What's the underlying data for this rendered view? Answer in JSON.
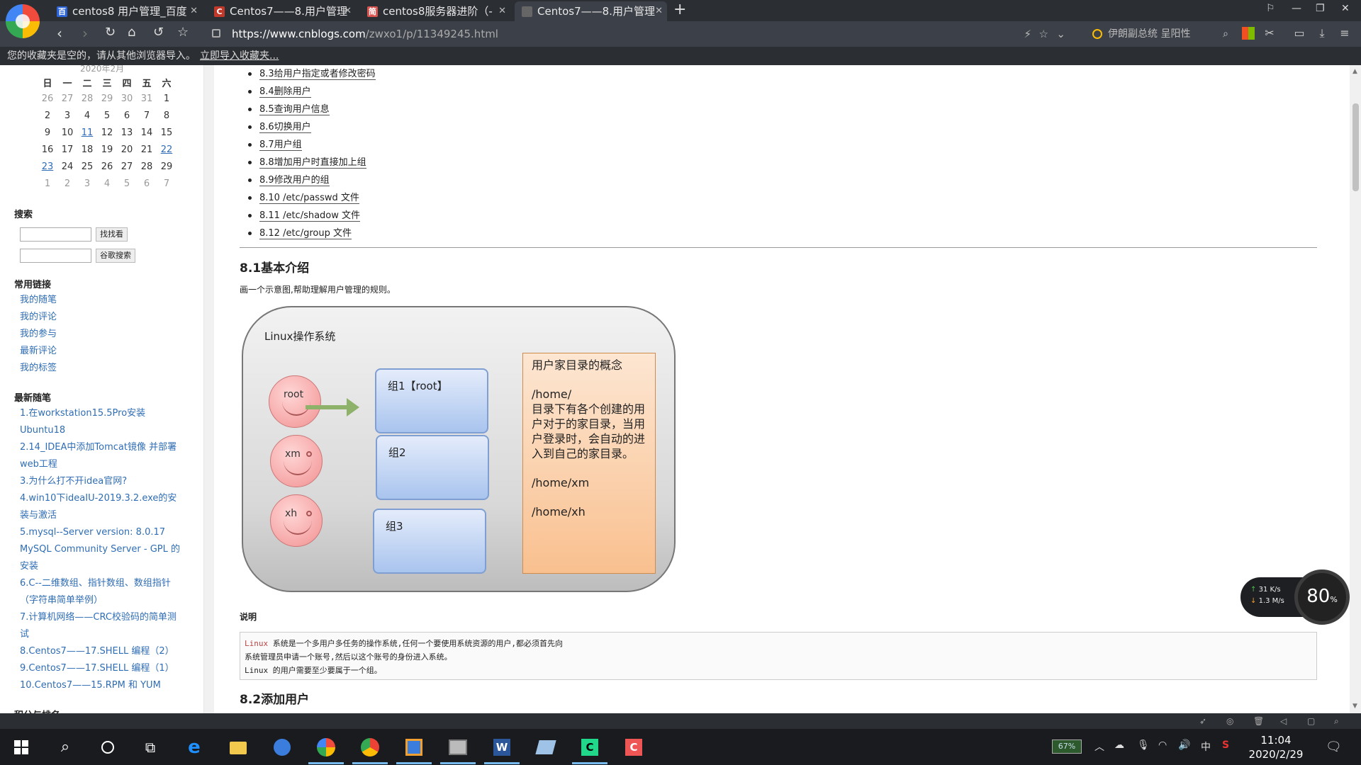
{
  "browser": {
    "tabs": [
      {
        "label": "centos8 用户管理_百度",
        "favicon_color": "#2d64d8",
        "favicon": "百"
      },
      {
        "label": "Centos7——8.用户管理",
        "favicon_color": "#c0392b",
        "favicon": "C"
      },
      {
        "label": "centos8服务器进阶（-",
        "favicon_color": "#d9534f",
        "favicon": "简"
      },
      {
        "label": "Centos7——8.用户管理",
        "favicon_color": "#666666",
        "favicon": ""
      }
    ],
    "url_host": "https://www.cnblogs.com",
    "url_path": "/zwxo1/p/11349245.html",
    "search_text": "伊朗副总统 呈阳性",
    "favbar_text": "您的收藏夹是空的，请从其他浏览器导入。",
    "favbar_link": "立即导入收藏夹..."
  },
  "sidebar": {
    "calendar": {
      "header": "2020年2月",
      "weekdays": [
        "日",
        "一",
        "二",
        "三",
        "四",
        "五",
        "六"
      ],
      "weeks": [
        [
          "26",
          "27",
          "28",
          "29",
          "30",
          "31",
          "1"
        ],
        [
          "2",
          "3",
          "4",
          "5",
          "6",
          "7",
          "8"
        ],
        [
          "9",
          "10",
          "11",
          "12",
          "13",
          "14",
          "15"
        ],
        [
          "16",
          "17",
          "18",
          "19",
          "20",
          "21",
          "22"
        ],
        [
          "23",
          "24",
          "25",
          "26",
          "27",
          "28",
          "29"
        ],
        [
          "1",
          "2",
          "3",
          "4",
          "5",
          "6",
          "7"
        ]
      ]
    },
    "search_title": "搜索",
    "search_btn": "找找看",
    "google_btn": "谷歌搜索",
    "links_title": "常用链接",
    "links": [
      "我的随笔",
      "我的评论",
      "我的参与",
      "最新评论",
      "我的标签"
    ],
    "recent_title": "最新随笔",
    "recent": [
      "1.在workstation15.5Pro安装",
      "Ubuntu18",
      "2.14_IDEA中添加Tomcat镜像 并部署",
      "web工程",
      "3.为什么打不开idea官网?",
      "4.win10下ideaIU-2019.3.2.exe的安",
      "装与激活",
      "5.mysql--Server version: 8.0.17",
      "MySQL Community Server - GPL 的",
      "安装",
      "6.C--二维数组、指针数组、数组指针",
      "（字符串简单举例）",
      "7.计算机网络——CRC校验码的简单测",
      "试",
      "8.Centos7——17.SHELL 编程（2）",
      "9.Centos7——17.SHELL 编程（1）",
      "10.Centos7——15.RPM 和 YUM"
    ],
    "rank_title": "积分与排名"
  },
  "content": {
    "toc": [
      "8.3给用户指定或者修改密码",
      "8.4删除用户",
      "8.5查询用户信息",
      "8.6切换用户",
      "8.7用户组",
      "8.8增加用户时直接加上组",
      "8.9修改用户的组",
      "8.10 /etc/passwd 文件",
      "8.11 /etc/shadow 文件",
      "8.12 /etc/group 文件"
    ],
    "sec1_title": "8.1基本介绍",
    "sec1_para": "画一个示意图,帮助理解用户管理的规则。",
    "diagram": {
      "title": "Linux操作系统",
      "users": [
        "root",
        "xm",
        "xh"
      ],
      "groups": [
        "组1【root】",
        "组2",
        "组3"
      ],
      "home_title": "用户家目录的概念",
      "home_lines": [
        "/home/",
        "目录下有各个创建的用户对于的家目录，当用户登录时，会自动的进入到自己的家目录。",
        "/home/xm",
        "/home/xh"
      ]
    },
    "note_title": "说明",
    "code_kw": "Linux",
    "code_line1_rest": " 系统是一个多用户多任务的操作系统,任何一个要使用系统资源的用户,都必须首先向",
    "code_line2": "系统管理员申请一个账号,然后以这个账号的身份进入系统。",
    "code_line3": "Linux 的用户需要至少要属于一个组。",
    "sec2_title": "8.2添加用户"
  },
  "netwidget": {
    "up": "31  K/s",
    "down": "1.3  M/s",
    "percent": "80",
    "percent_unit": "%"
  },
  "taskbar": {
    "battery": "67%",
    "time": "11:04",
    "date": "2020/2/29",
    "ime": "中"
  }
}
